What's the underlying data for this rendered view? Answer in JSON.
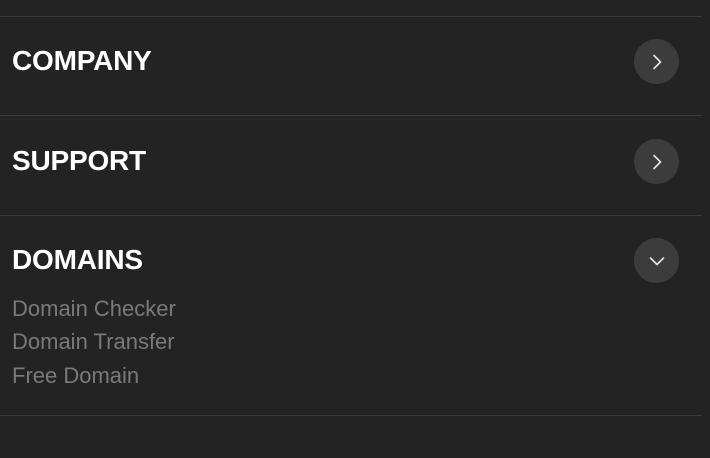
{
  "footer_menu": {
    "sections": [
      {
        "title": "COMPANY",
        "state": "collapsed",
        "toggle_icon": "chevron-right-icon"
      },
      {
        "title": "SUPPORT",
        "state": "collapsed",
        "toggle_icon": "chevron-right-icon"
      },
      {
        "title": "DOMAINS",
        "state": "expanded",
        "toggle_icon": "chevron-down-icon",
        "links": [
          "Domain Checker",
          "Domain Transfer",
          "Free Domain"
        ]
      }
    ]
  },
  "colors": {
    "background": "#232323",
    "divider": "#3a3a3a",
    "title": "#ffffff",
    "link": "#7a7a7a",
    "toggle_bg": "#3c3c3c",
    "toggle_icon": "#e6e6e6"
  }
}
